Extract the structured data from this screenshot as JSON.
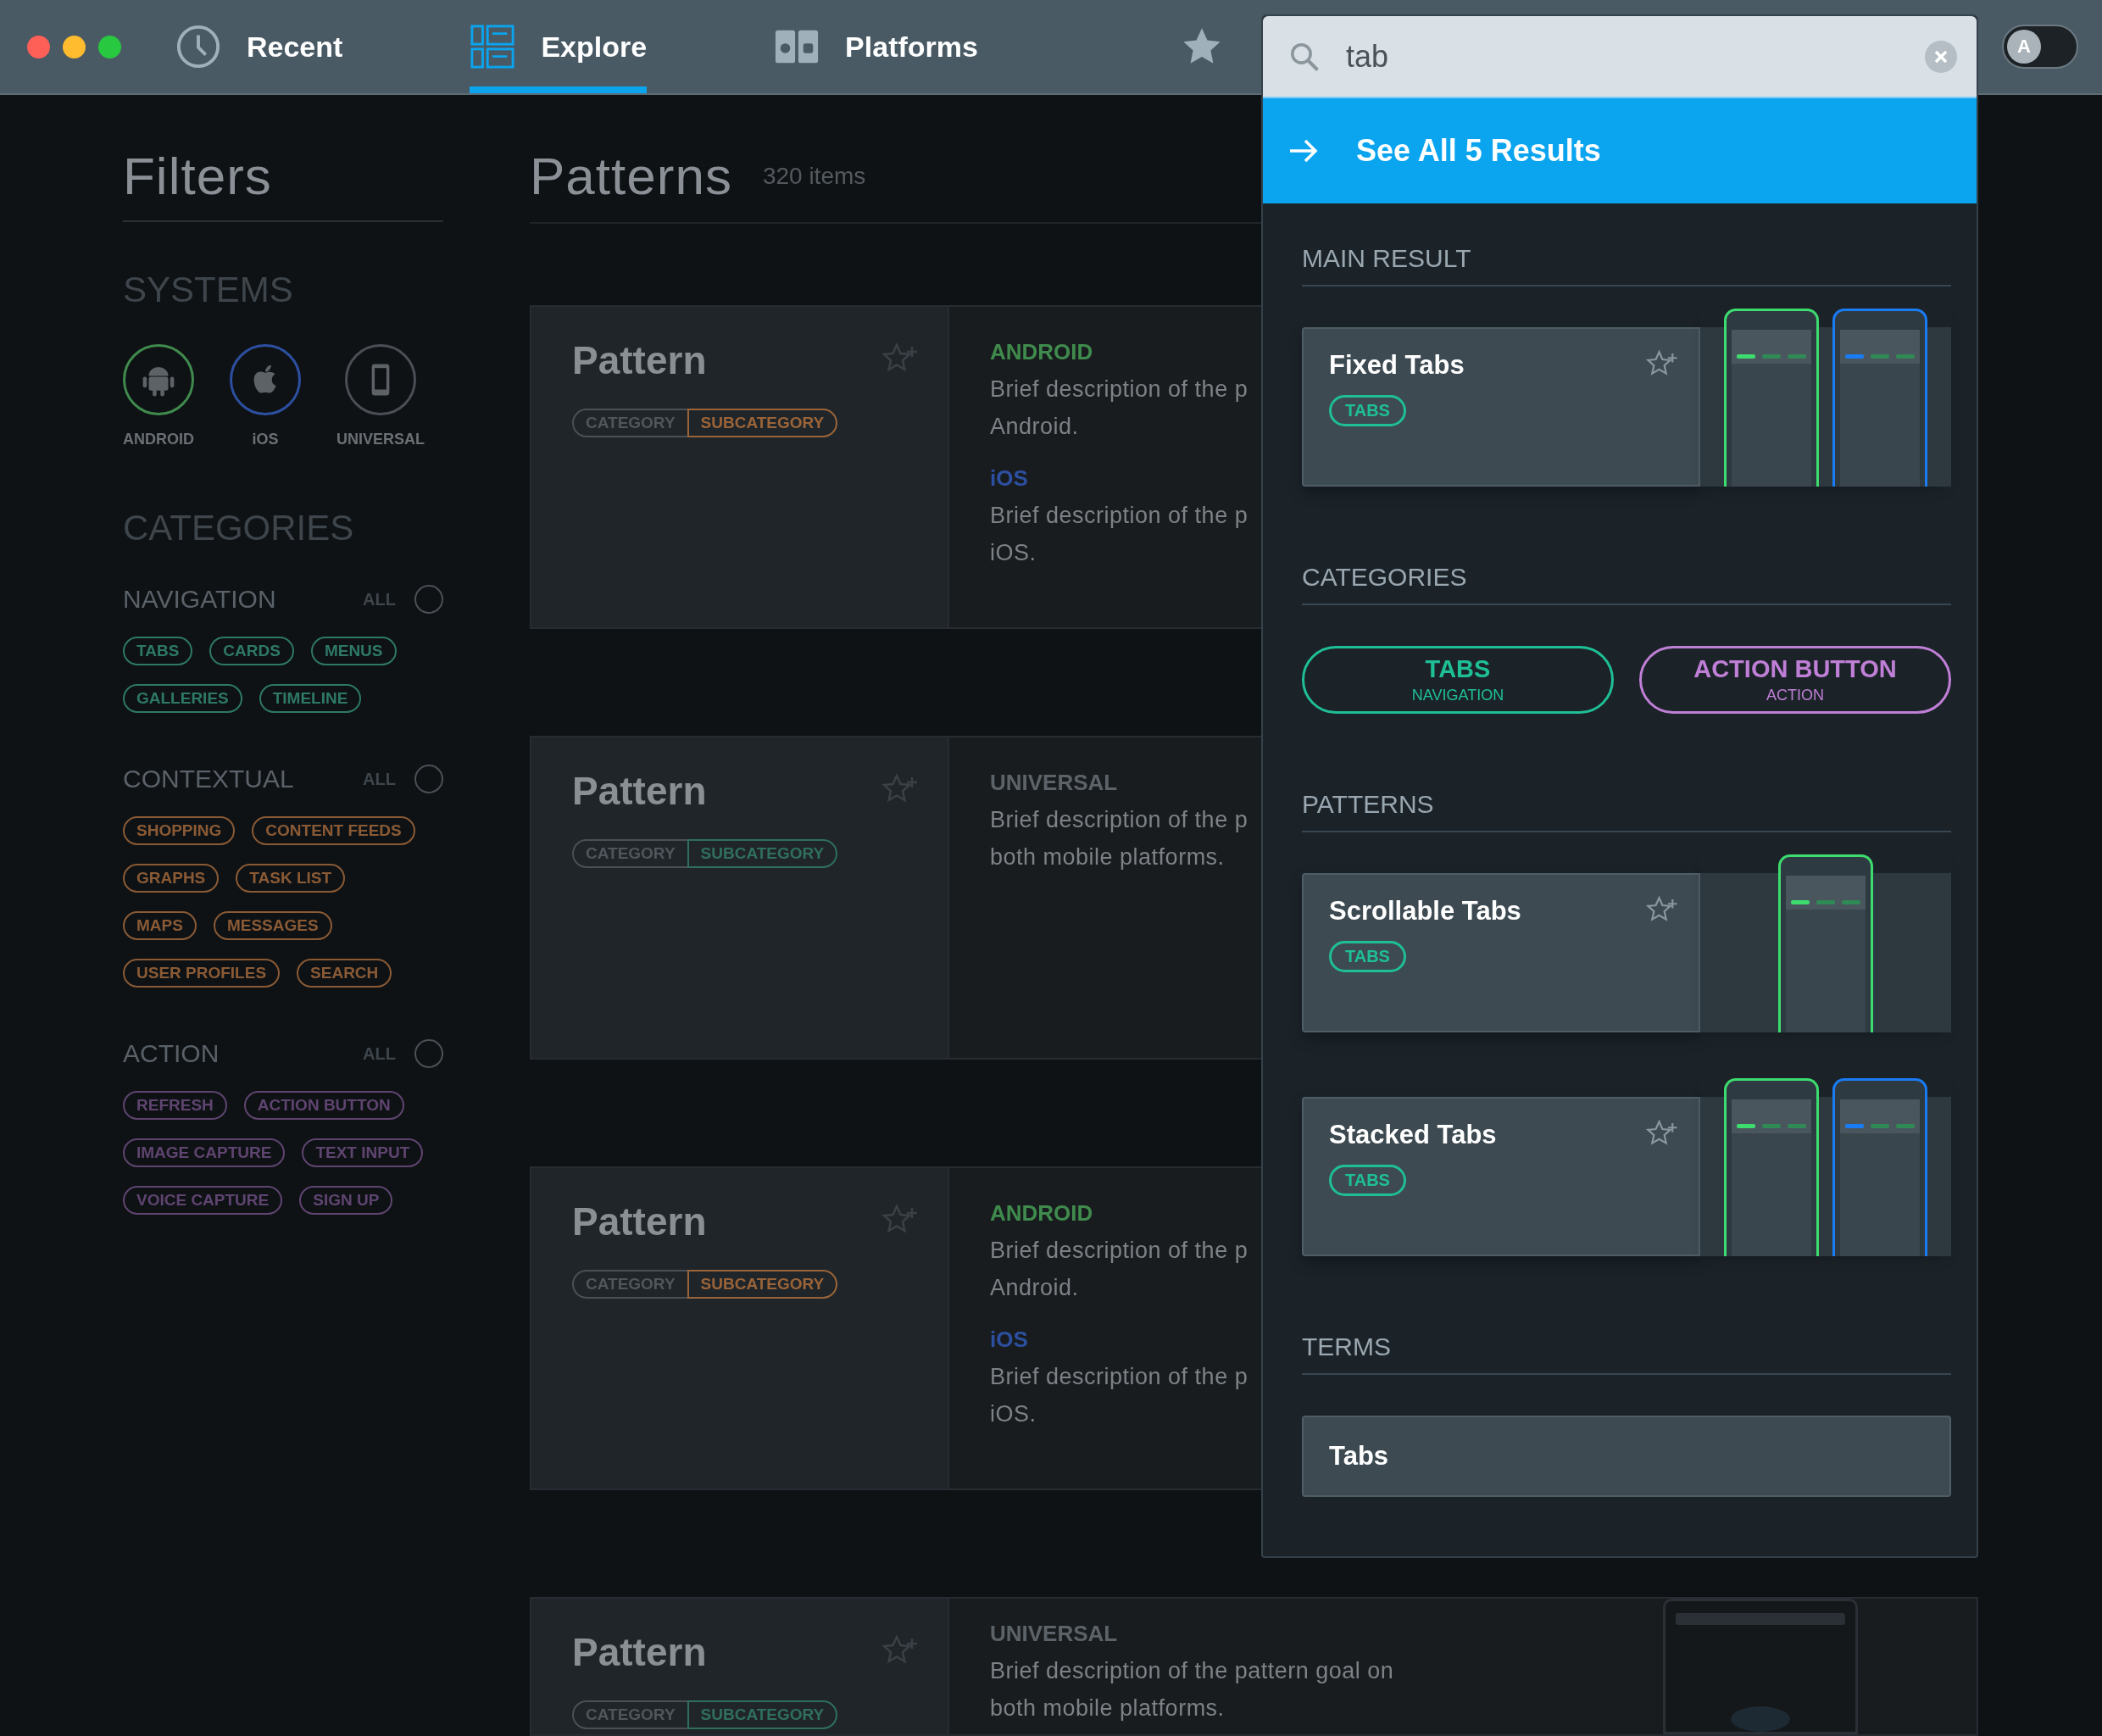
{
  "window": {
    "controls": [
      {
        "color": "#fe5f57"
      },
      {
        "color": "#febc2e"
      },
      {
        "color": "#28c840"
      }
    ]
  },
  "tabs": [
    {
      "label": "Recent",
      "selected": false,
      "kind": "clock"
    },
    {
      "label": "Explore",
      "selected": true,
      "kind": "layout"
    },
    {
      "label": "Platforms",
      "selected": false,
      "kind": "devices"
    }
  ],
  "theme_toggle": {
    "label": "A",
    "on": false
  },
  "filters": {
    "title": "Filters",
    "systems_heading": "SYSTEMS",
    "systems": [
      {
        "label": "ANDROID",
        "kind": "android",
        "color": "#3f8a4c"
      },
      {
        "label": "iOS",
        "kind": "ios",
        "color": "#2d4fa0"
      },
      {
        "label": "UNIVERSAL",
        "kind": "universal",
        "color": "#4a4f55"
      }
    ],
    "categories_heading": "CATEGORIES",
    "groups": [
      {
        "name": "NAVIGATION",
        "all_label": "ALL",
        "checked": false,
        "color": "#2e7866",
        "chips": [
          "TABS",
          "CARDS",
          "MENUS",
          "GALLERIES",
          "TIMELINE"
        ]
      },
      {
        "name": "CONTEXTUAL",
        "all_label": "ALL",
        "checked": false,
        "color": "#8a5a35",
        "chips": [
          "SHOPPING",
          "CONTENT FEEDS",
          "GRAPHS",
          "TASK LIST",
          "MAPS",
          "MESSAGES",
          "USER PROFILES",
          "SEARCH"
        ]
      },
      {
        "name": "ACTION",
        "all_label": "ALL",
        "checked": false,
        "color": "#5f4470",
        "chips": [
          "REFRESH",
          "ACTION BUTTON",
          "IMAGE CAPTURE",
          "TEXT INPUT",
          "VOICE CAPTURE",
          "SIGN UP"
        ]
      }
    ]
  },
  "patterns": {
    "title": "Patterns",
    "count": "320 items",
    "cards": [
      {
        "title": "Pattern",
        "category": "CATEGORY",
        "subcategory": "SUBCATEGORY",
        "color": "#9a6438",
        "platforms": [
          {
            "kind": "android",
            "label": "ANDROID",
            "lines": [
              "Brief description of the p",
              "Android."
            ]
          },
          {
            "kind": "ios",
            "label": "iOS",
            "lines": [
              "Brief description of the p",
              "iOS."
            ]
          }
        ]
      },
      {
        "title": "Pattern",
        "category": "CATEGORY",
        "subcategory": "SUBCATEGORY",
        "color": "#2f6f5c",
        "platforms": [
          {
            "kind": "universal",
            "label": "UNIVERSAL",
            "lines": [
              "Brief description of the p",
              "both mobile platforms."
            ]
          }
        ]
      },
      {
        "title": "Pattern",
        "category": "CATEGORY",
        "subcategory": "SUBCATEGORY",
        "color": "#9a6438",
        "platforms": [
          {
            "kind": "android",
            "label": "ANDROID",
            "lines": [
              "Brief description of the p",
              "Android."
            ]
          },
          {
            "kind": "ios",
            "label": "iOS",
            "lines": [
              "Brief description of the p",
              "iOS."
            ]
          }
        ]
      },
      {
        "title": "Pattern",
        "category": "CATEGORY",
        "subcategory": "SUBCATEGORY",
        "color": "#2f6f5c",
        "platforms": [
          {
            "kind": "universal",
            "label": "UNIVERSAL",
            "lines": [
              "Brief description of the pattern goal on",
              "both mobile platforms."
            ]
          }
        ],
        "previews": [
          {
            "kind": "universal"
          }
        ]
      }
    ]
  },
  "search": {
    "value": "tab",
    "see_all": "See All 5 Results",
    "sections": [
      {
        "kind": "results",
        "heading": "MAIN RESULT",
        "items": [
          {
            "title": "Fixed Tabs",
            "tag": "TABS",
            "previews": [
              {
                "kind": "android"
              },
              {
                "kind": "ios"
              }
            ]
          }
        ]
      },
      {
        "kind": "categories",
        "heading": "CATEGORIES",
        "items": [
          {
            "title": "TABS",
            "subtitle": "NAVIGATION",
            "color": "#1fbf96"
          },
          {
            "title": "ACTION BUTTON",
            "subtitle": "ACTION",
            "color": "#c07fd6"
          }
        ]
      },
      {
        "kind": "results",
        "heading": "PATTERNS",
        "items": [
          {
            "title": "Scrollable Tabs",
            "tag": "TABS",
            "previews": [
              {
                "kind": "android"
              }
            ]
          },
          {
            "title": "Stacked Tabs",
            "tag": "TABS",
            "previews": [
              {
                "kind": "android"
              },
              {
                "kind": "ios"
              }
            ]
          }
        ]
      },
      {
        "kind": "terms",
        "heading": "TERMS",
        "items": [
          {
            "title": "Tabs"
          }
        ]
      }
    ]
  }
}
